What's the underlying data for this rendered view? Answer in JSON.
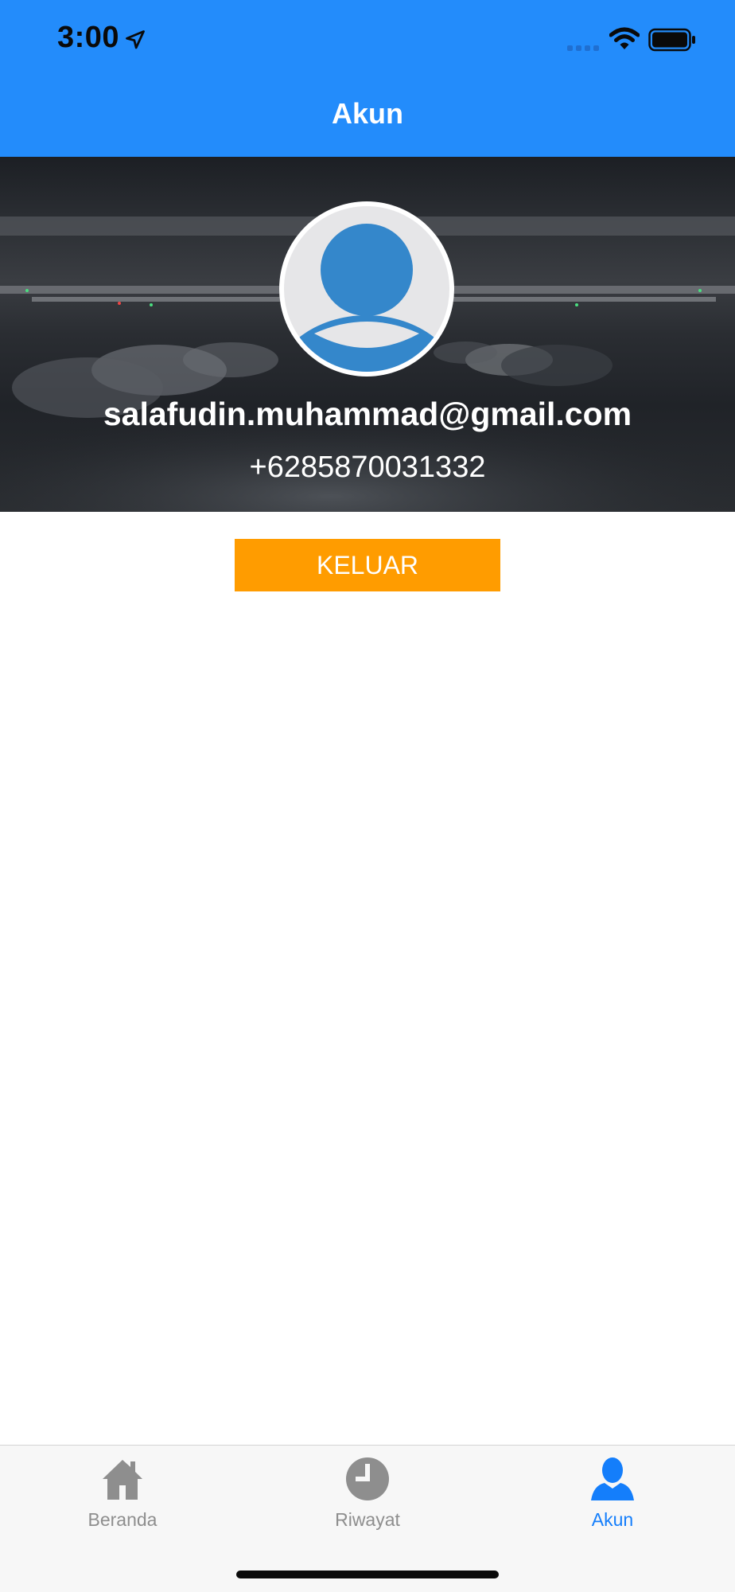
{
  "status_bar": {
    "time": "3:00",
    "icons": [
      "location-arrow-icon",
      "signal-icon",
      "wifi-icon",
      "battery-icon"
    ]
  },
  "nav": {
    "title": "Akun"
  },
  "profile": {
    "avatar_icon": "user-avatar-icon",
    "email": "salafudin.muhammad@gmail.com",
    "phone": "+6285870031332"
  },
  "actions": {
    "logout_label": "KELUAR"
  },
  "tabs": [
    {
      "label": "Beranda",
      "icon": "home-icon",
      "active": false
    },
    {
      "label": "Riwayat",
      "icon": "clock-icon",
      "active": false
    },
    {
      "label": "Akun",
      "icon": "user-icon",
      "active": true
    }
  ],
  "colors": {
    "primary": "#238cfb",
    "accent": "#ff9c00",
    "tab_active": "#147efb",
    "tab_inactive": "#8e8e8e",
    "avatar_blue": "#3487cb"
  }
}
